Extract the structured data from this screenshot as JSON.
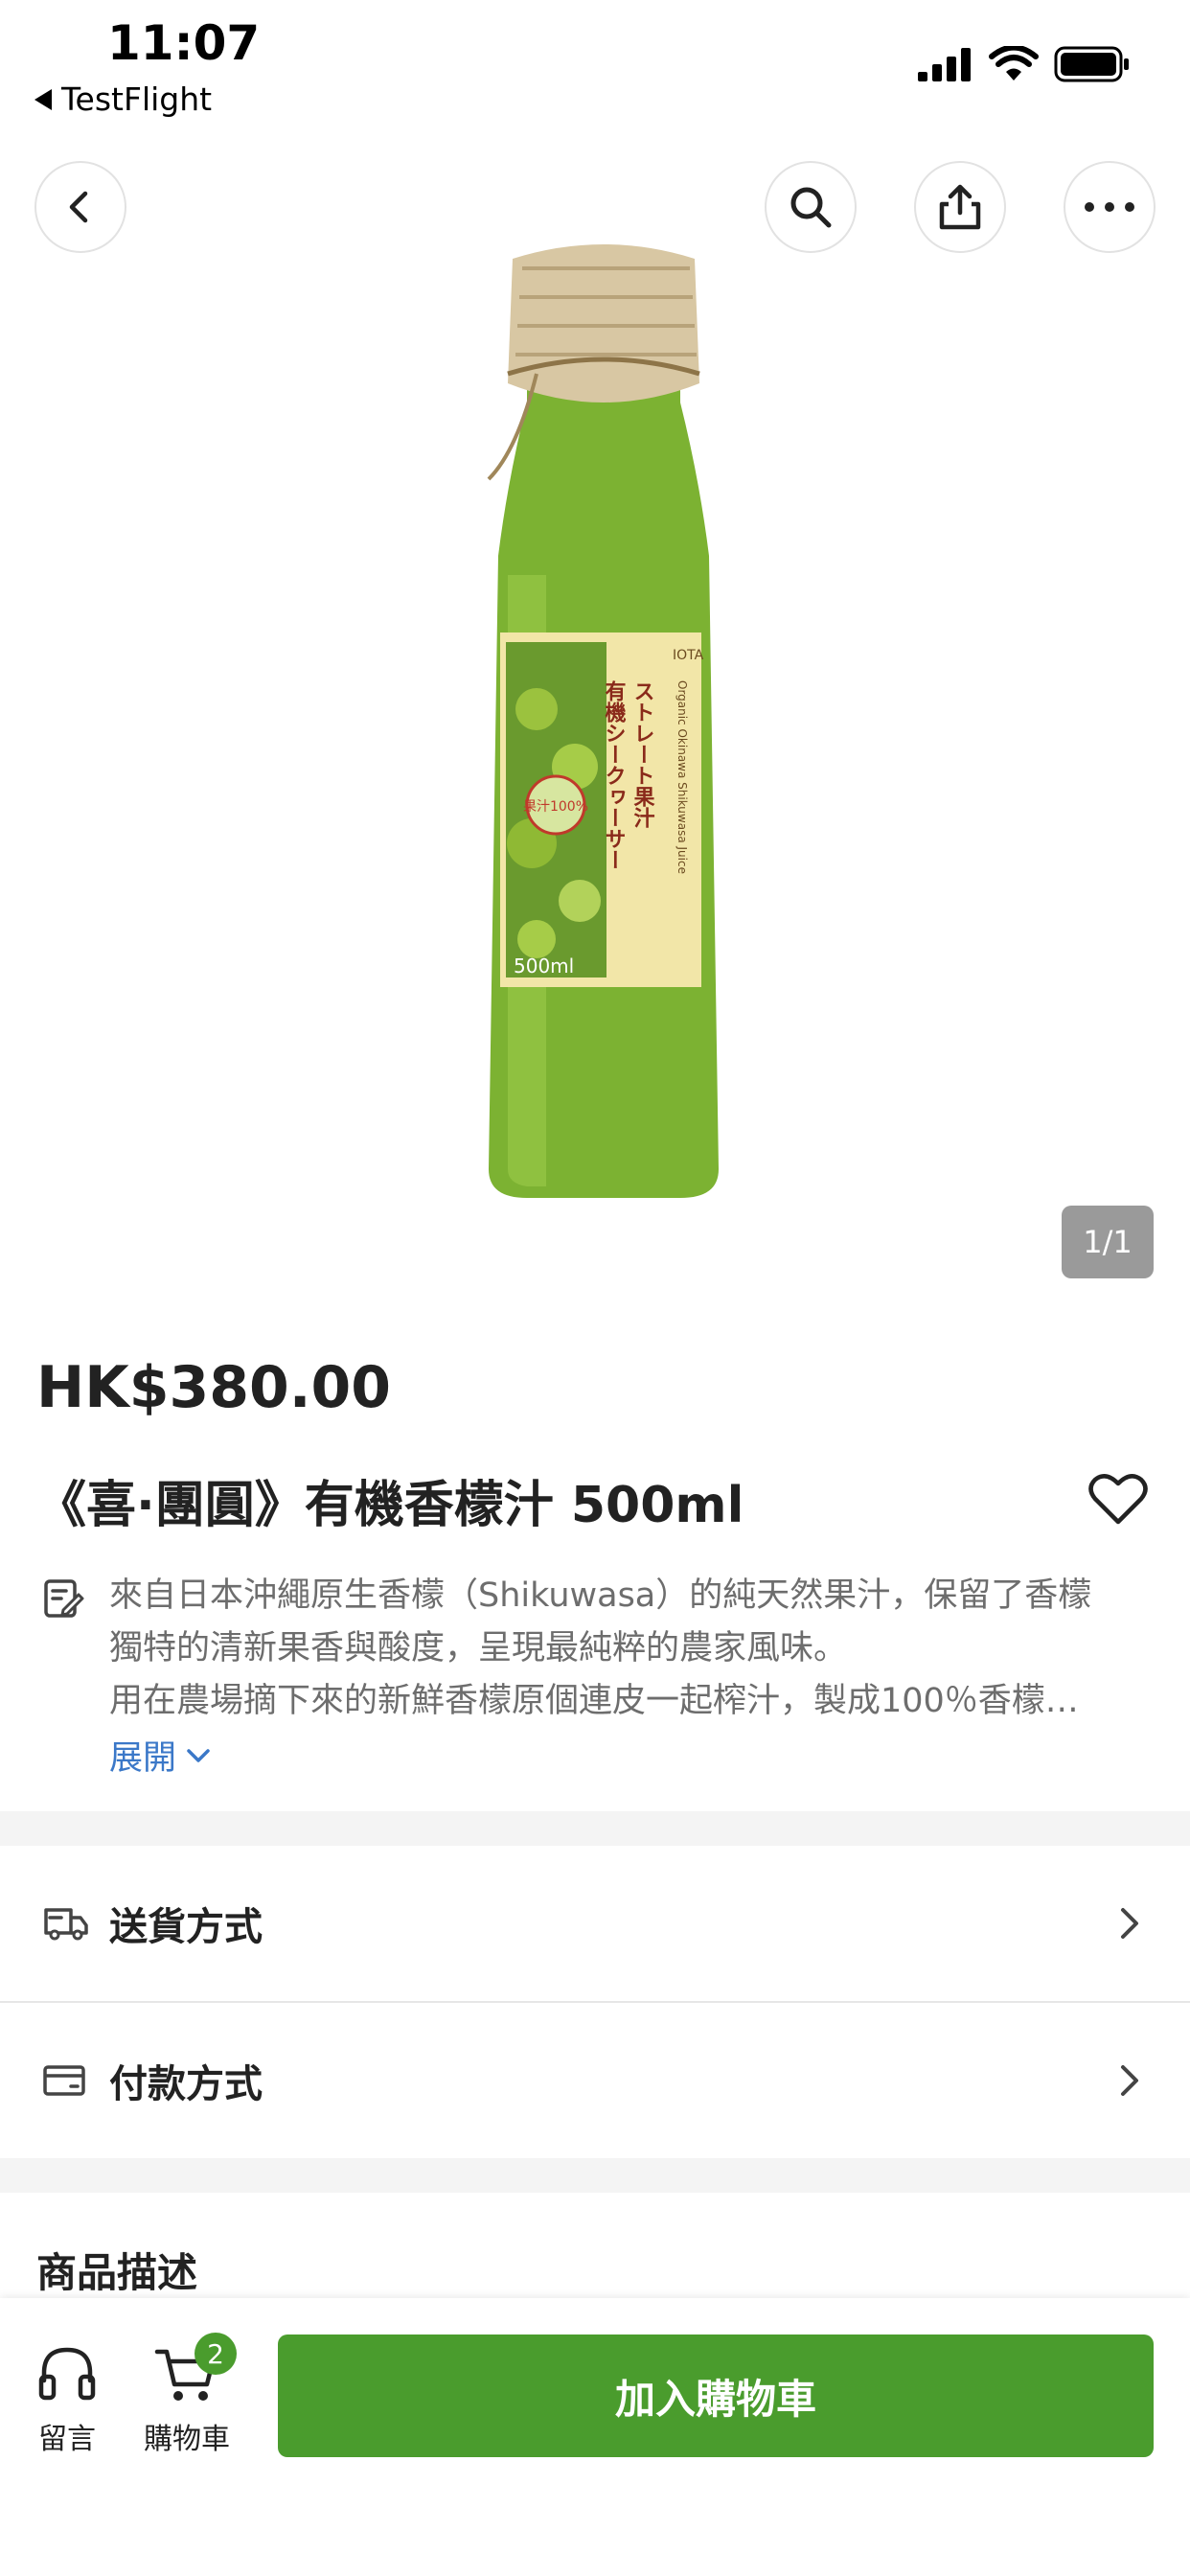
{
  "status_bar": {
    "time": "11:07",
    "back_app": "TestFlight"
  },
  "nav": {
    "icons": [
      "chevron-left-icon",
      "search-icon",
      "share-icon",
      "more-icon"
    ]
  },
  "product": {
    "image_page": "1/1",
    "bottle_label": {
      "title_line1": "有機シークヮーサー",
      "title_line2": "ストレート果汁",
      "volume": "500ml",
      "english": "Organic Okinawa Shikuwasa Juice",
      "seal": "果汁100%",
      "cert": "IOTA"
    },
    "price": "HK$380.00",
    "title": "《喜·團圓》有機香檬汁 500ml",
    "description": [
      "來自日本沖繩原生香檬（Shikuwasa）的純天然果汁，保留了香檬",
      "獨特的清新果香與酸度，呈現最純粹的農家風味。",
      "用在農場摘下來的新鮮香檬原個連皮一起榨汁，製成100％香檬…"
    ],
    "expand_label": "展開"
  },
  "options": {
    "shipping_label": "送貨方式",
    "payment_label": "付款方式"
  },
  "section": {
    "description_title": "商品描述"
  },
  "bottom_bar": {
    "chat_label": "留言",
    "cart_label": "購物車",
    "cart_count": "2",
    "add_to_cart_label": "加入購物車"
  },
  "colors": {
    "accent_green": "#4a9c2d",
    "link_blue": "#3b78c8"
  }
}
